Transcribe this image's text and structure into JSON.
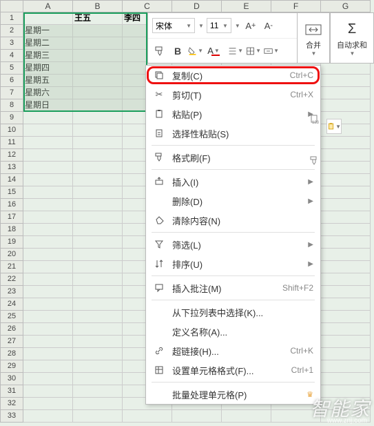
{
  "columns": [
    "A",
    "B",
    "C",
    "D",
    "E",
    "F",
    "G"
  ],
  "rows": [
    "1",
    "2",
    "3",
    "4",
    "5",
    "6",
    "7",
    "8",
    "9",
    "10",
    "11",
    "12",
    "13",
    "14",
    "15",
    "16",
    "17",
    "18",
    "19",
    "20",
    "21",
    "22",
    "23",
    "24",
    "25",
    "26",
    "27",
    "28",
    "29",
    "30",
    "31",
    "32",
    "33"
  ],
  "cells": {
    "B1": "王五",
    "C1": "李四",
    "A2": "星期一",
    "A3": "星期二",
    "A4": "星期三",
    "A5": "星期四",
    "A6": "星期五",
    "A7": "星期六",
    "A8": "星期日"
  },
  "toolbar": {
    "font": "宋体",
    "size": "11",
    "merge_label": "合并",
    "autosum_label": "自动求和"
  },
  "ctx": {
    "copy": {
      "label": "复制(C)",
      "shortcut": "Ctrl+C"
    },
    "cut": {
      "label": "剪切(T)",
      "shortcut": "Ctrl+X"
    },
    "paste": {
      "label": "粘贴(P)"
    },
    "paste_special": {
      "label": "选择性粘贴(S)"
    },
    "format_painter": {
      "label": "格式刷(F)"
    },
    "insert": {
      "label": "插入(I)"
    },
    "delete": {
      "label": "删除(D)"
    },
    "clear": {
      "label": "清除内容(N)"
    },
    "filter": {
      "label": "筛选(L)"
    },
    "sort": {
      "label": "排序(U)"
    },
    "comment": {
      "label": "插入批注(M)",
      "shortcut": "Shift+F2"
    },
    "dropdown": {
      "label": "从下拉列表中选择(K)..."
    },
    "define_name": {
      "label": "定义名称(A)..."
    },
    "hyperlink": {
      "label": "超链接(H)...",
      "shortcut": "Ctrl+K"
    },
    "format_cells": {
      "label": "设置单元格格式(F)...",
      "shortcut": "Ctrl+1"
    },
    "batch": {
      "label": "批量处理单元格(P)"
    }
  },
  "watermark": {
    "main": "智能家",
    "sub": "www.znj.com"
  }
}
